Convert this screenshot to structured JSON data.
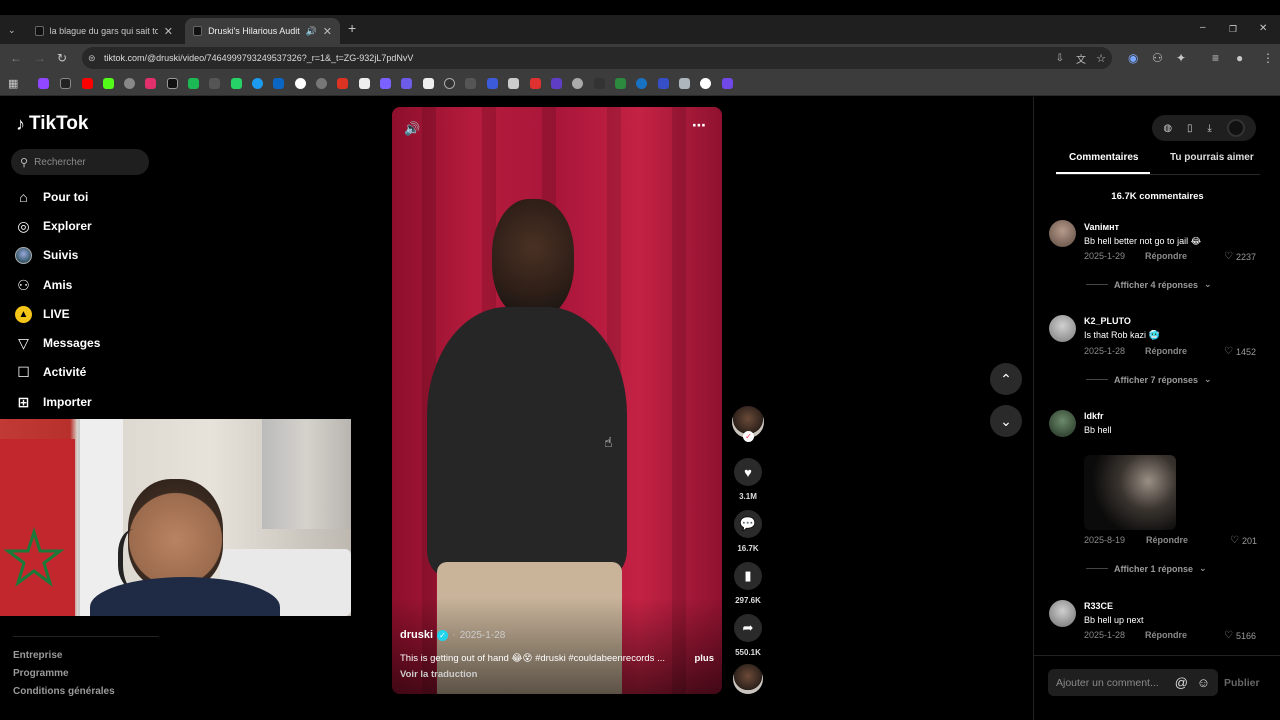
{
  "browser": {
    "tabs": [
      {
        "title": "la blague du gars qui sait tout 😂",
        "active": false
      },
      {
        "title": "Druski's Hilarious Audition",
        "active": true
      }
    ],
    "url": "tiktok.com/@druski/video/7464999793249537326?_r=1&_t=ZG-932jL7pdNvV"
  },
  "nav": {
    "brand": "TikTok",
    "search_placeholder": "Rechercher",
    "items": [
      {
        "label": "Pour toi",
        "icon": "home-icon"
      },
      {
        "label": "Explorer",
        "icon": "compass-icon"
      },
      {
        "label": "Suivis",
        "icon": "following-avatar-icon"
      },
      {
        "label": "Amis",
        "icon": "friends-icon"
      },
      {
        "label": "LIVE",
        "icon": "live-icon"
      },
      {
        "label": "Messages",
        "icon": "paper-plane-icon"
      },
      {
        "label": "Activité",
        "icon": "activity-icon"
      },
      {
        "label": "Importer",
        "icon": "plus-square-icon"
      }
    ],
    "footer": [
      "Entreprise",
      "Programme",
      "Conditions générales"
    ]
  },
  "video": {
    "author": "druski",
    "date": "2025-1-28",
    "caption": "This is getting out of hand 😂😵 #druski #couldabeenrecords ...",
    "more_label": "plus",
    "translate_label": "Voir la traduction"
  },
  "actions": {
    "likes": "3.1M",
    "comments": "16.7K",
    "saves": "297.6K",
    "shares": "550.1K"
  },
  "comments_panel": {
    "tab_comments": "Commentaires",
    "tab_suggestions": "Tu pourrais aimer",
    "count": "16.7K commentaires",
    "reply_label": "Répondre",
    "comments": [
      {
        "user": "Vaniᴍʜᴛ",
        "text": "Bb hell better not go to jail 😂",
        "date": "2025-1-29",
        "likes": "2237",
        "more": "Afficher 4 réponses"
      },
      {
        "user": "K2_PLUTO",
        "text": "Is that Rob kazi 🥶",
        "date": "2025-1-28",
        "likes": "1452",
        "more": "Afficher 7 réponses"
      },
      {
        "user": "ldkfr",
        "text": "Bb hell",
        "date": "2025-8-19",
        "likes": "201",
        "more": "Afficher 1 réponse"
      },
      {
        "user": "R33CE",
        "text": "Bb hell up next",
        "date": "2025-1-28",
        "likes": "5166",
        "more": ""
      }
    ],
    "input_placeholder": "Ajouter un comment...",
    "publish_label": "Publier"
  },
  "colors": {
    "curtain": "#b51b3c",
    "like_red": "#fe2c55",
    "verified": "#20d5ec"
  }
}
